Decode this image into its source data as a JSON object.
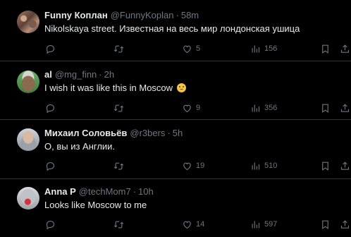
{
  "tweets": [
    {
      "name": "Funny Коплан",
      "handle": "@FunnyKoplan",
      "time": "58m",
      "text": "Nikolskaya street. Известная на весь мир лондонская ушица",
      "emoji": "",
      "replies": "",
      "retweets": "",
      "likes": "5",
      "views": "156"
    },
    {
      "name": "al",
      "handle": "@mg_finn",
      "time": "2h",
      "text": "I wish it was like this in Moscow",
      "emoji": "pleading-face-emoji",
      "replies": "",
      "retweets": "",
      "likes": "9",
      "views": "356"
    },
    {
      "name": "Михаил Соловьёв",
      "handle": "@r3bers",
      "time": "5h",
      "text": "О, вы из Англии.",
      "emoji": "",
      "replies": "",
      "retweets": "",
      "likes": "19",
      "views": "510"
    },
    {
      "name": "Anna P",
      "handle": "@techMom7",
      "time": "10h",
      "text": "Looks like Moscow to me",
      "emoji": "",
      "replies": "",
      "retweets": "",
      "likes": "14",
      "views": "597"
    }
  ],
  "separator": "·",
  "colors": {
    "background": "#000000",
    "text": "#e7e9ea",
    "muted": "#71767b",
    "divider": "#2f3336"
  },
  "icons": [
    "reply-icon",
    "retweet-icon",
    "like-icon",
    "views-icon",
    "bookmark-icon",
    "share-icon"
  ]
}
